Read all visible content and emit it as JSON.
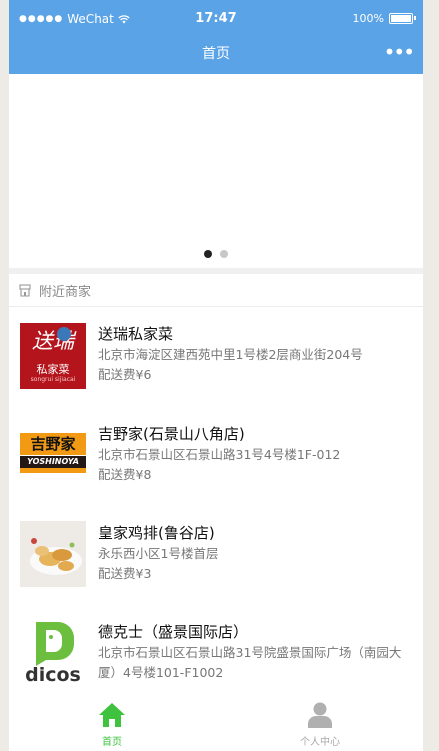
{
  "status_bar": {
    "carrier": "WeChat",
    "signal_dots": "●●●●●",
    "time": "17:47",
    "battery": "100%"
  },
  "nav": {
    "title": "首页",
    "more": "•••"
  },
  "banner": {
    "page_count": 2,
    "active_index": 0
  },
  "nearby": {
    "title": "附近商家"
  },
  "merchants": [
    {
      "name": "送瑞私家菜",
      "address": "北京市海淀区建西苑中里1号楼2层商业街204号",
      "fee": "配送费¥6",
      "logo_text": "送瑞",
      "logo_sub": "私家菜",
      "logo_tiny": "songrui sijiacai"
    },
    {
      "name": "吉野家(石景山八角店)",
      "address": "北京市石景山区石景山路31号4号楼1F-012",
      "fee": "配送费¥8",
      "logo_text": "吉野家",
      "logo_sub": "YOSHINOYA"
    },
    {
      "name": "皇家鸡排(鲁谷店)",
      "address": "永乐西小区1号楼首层",
      "fee": "配送费¥3"
    },
    {
      "name": "德克士（盛景国际店）",
      "address": "北京市石景山区石景山路31号院盛景国际广场（南园大厦）4号楼101-F1002",
      "fee": "",
      "logo_text": "dicos"
    }
  ],
  "tabbar": {
    "home": "首页",
    "me": "个人中心"
  },
  "colors": {
    "nav_bg": "#5aa3e6",
    "tab_active": "#3fc33f",
    "tab_inactive": "#a8a8a8"
  }
}
